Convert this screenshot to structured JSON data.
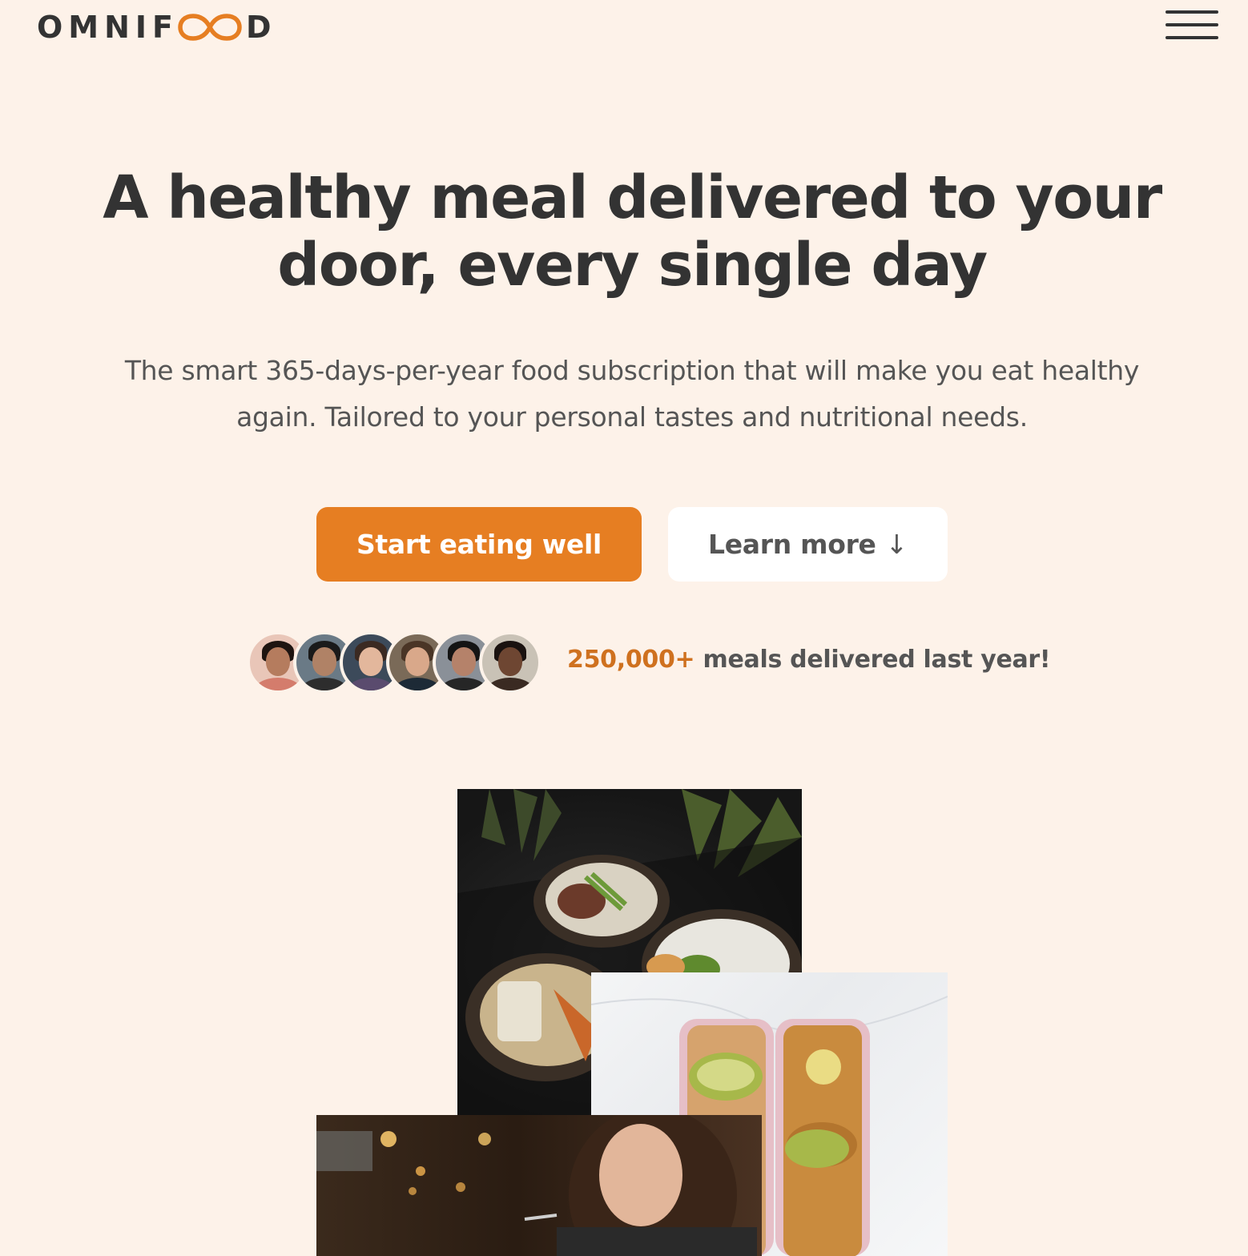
{
  "header": {
    "logo_left": "OMNIF",
    "logo_right": "D",
    "logo_color": "#e67e22",
    "menu_icon": "hamburger-menu-icon"
  },
  "hero": {
    "title_line1": "A healthy meal delivered to your",
    "title_line2": "door, every single day",
    "description_line1": "The smart 365-days-per-year food subscription that will make you eat healthy",
    "description_line2": "again. Tailored to your personal tastes and nutritional needs.",
    "primary_button": "Start eating well",
    "secondary_button": "Learn more",
    "secondary_button_icon": "↓",
    "accent_color": "#e67e22"
  },
  "customers": {
    "count": "250,000+",
    "text": " meals delivered last year!",
    "avatars": [
      "customer-1",
      "customer-2",
      "customer-3",
      "customer-4",
      "customer-5",
      "customer-6"
    ]
  },
  "images": [
    "bowls-photo",
    "meal-prep-boxes-photo",
    "woman-eating-photo"
  ]
}
